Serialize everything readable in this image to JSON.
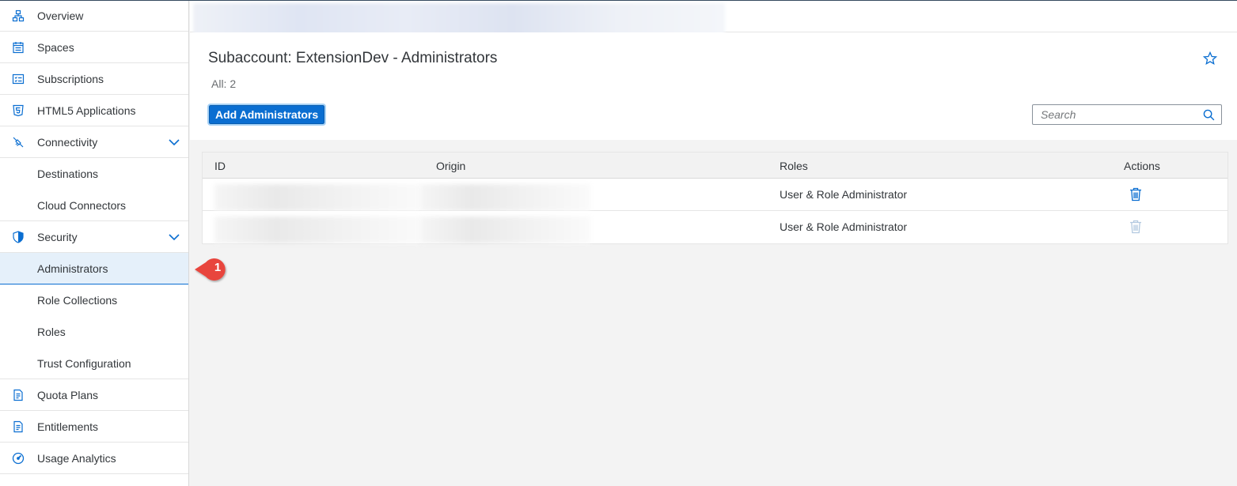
{
  "sidebar": {
    "items": [
      {
        "label": "Overview",
        "icon": "hierarchy-icon"
      },
      {
        "label": "Spaces",
        "icon": "calendar-icon"
      },
      {
        "label": "Subscriptions",
        "icon": "checklist-icon"
      },
      {
        "label": "HTML5 Applications",
        "icon": "html5-icon"
      },
      {
        "label": "Connectivity",
        "icon": "connectivity-icon",
        "expanded": true
      },
      {
        "label": "Destinations"
      },
      {
        "label": "Cloud Connectors"
      },
      {
        "label": "Security",
        "icon": "shield-icon",
        "expanded": true
      },
      {
        "label": "Administrators",
        "selected": true
      },
      {
        "label": "Role Collections"
      },
      {
        "label": "Roles"
      },
      {
        "label": "Trust Configuration"
      },
      {
        "label": "Quota Plans",
        "icon": "document-icon"
      },
      {
        "label": "Entitlements",
        "icon": "document-icon"
      },
      {
        "label": "Usage Analytics",
        "icon": "gauge-icon"
      }
    ]
  },
  "header": {
    "title": "Subaccount: ExtensionDev - Administrators",
    "count": "All: 2",
    "add_button": "Add Administrators",
    "search_placeholder": "Search"
  },
  "table": {
    "columns": [
      "ID",
      "Origin",
      "Roles",
      "Actions"
    ],
    "rows": [
      {
        "roles": "User & Role Administrator",
        "delete_enabled": true
      },
      {
        "roles": "User & Role Administrator",
        "delete_enabled": false
      }
    ]
  },
  "callout": {
    "number": "1"
  },
  "colors": {
    "accent": "#0a6ed1",
    "callout": "#e8453c",
    "selected_bg": "#e5f0fa"
  }
}
